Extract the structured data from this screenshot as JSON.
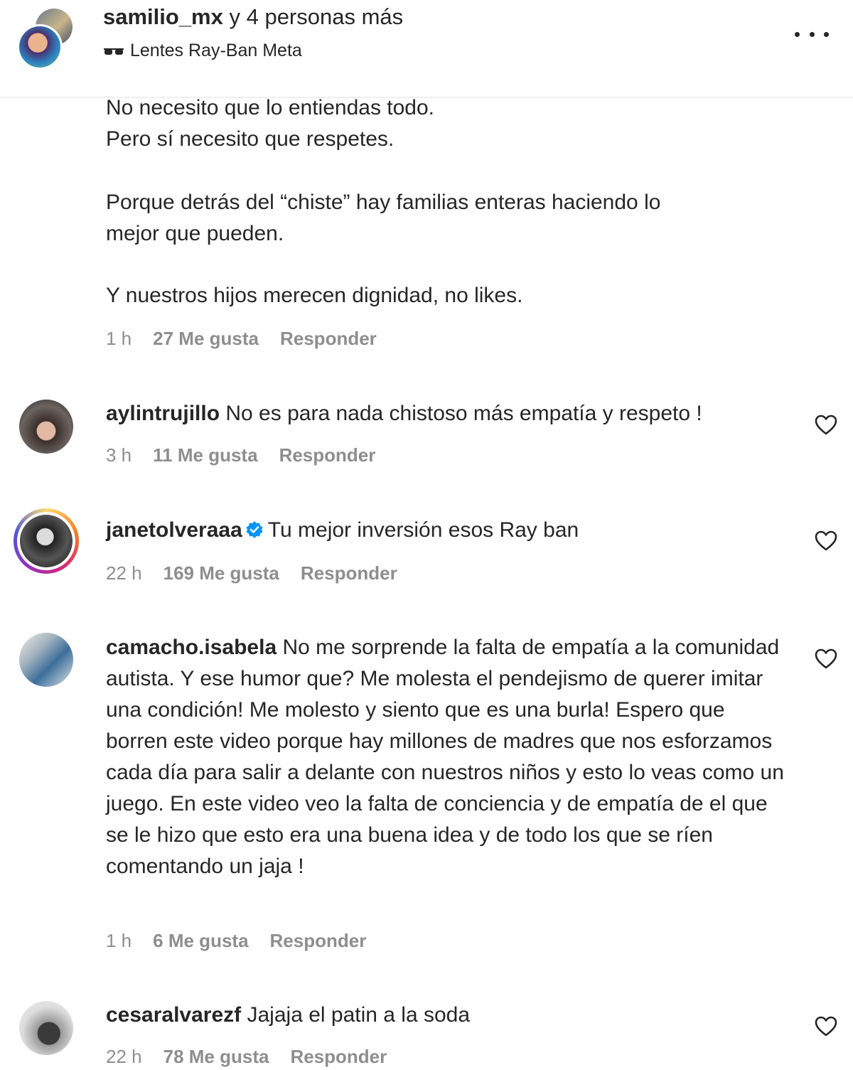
{
  "header": {
    "title_user": "samilio_mx",
    "title_rest": " y 4 personas más",
    "subtitle": "Lentes Ray-Ban Meta",
    "subtitle_icon": "glasses-icon",
    "menu_icon": "more-options-icon"
  },
  "main_comment": {
    "lines": [
      "No necesito que lo entiendas todo.",
      "Pero sí necesito que respetes.",
      "Porque detrás del “chiste” hay familias enteras haciendo lo",
      "mejor que pueden.",
      "Y nuestros hijos merecen dignidad, no likes."
    ],
    "time": "1 h",
    "likes": "27 Me gusta",
    "reply": "Responder"
  },
  "comments": [
    {
      "username": "aylintrujillo",
      "text": "No es para nada chistoso más empatía y respeto !",
      "time": "3 h",
      "likes": "11 Me gusta",
      "reply": "Responder"
    },
    {
      "username": "janetolveraaa",
      "verified": true,
      "text": "Tu mejor inversión esos Ray ban",
      "time": "22 h",
      "likes": "169 Me gusta",
      "reply": "Responder"
    },
    {
      "username": "camacho.isabela",
      "text": "No me sorprende la falta de empatía a la comunidad autista. Y ese humor que? Me molesta el pendejismo de querer imitar una condición! Me molesto y siento que es una burla! Espero que borren este video porque hay millones de madres que nos esforzamos cada día para salir a delante con nuestros niños y esto lo veas como un juego. En este video veo la falta de conciencia y de empatía de el que se le hizo que esto era una buena idea y de todo los que se ríen comentando un jaja !",
      "time": "1 h",
      "likes": "6 Me gusta",
      "reply": "Responder"
    },
    {
      "username": "cesaralvarezf",
      "text": "Jajaja el patin a la soda",
      "time": "22 h",
      "likes": "78 Me gusta",
      "reply": "Responder"
    }
  ],
  "colors": {
    "text": "#262626",
    "secondary": "#8e8e8e",
    "verified": "#0095f6",
    "divider": "#efefef"
  }
}
